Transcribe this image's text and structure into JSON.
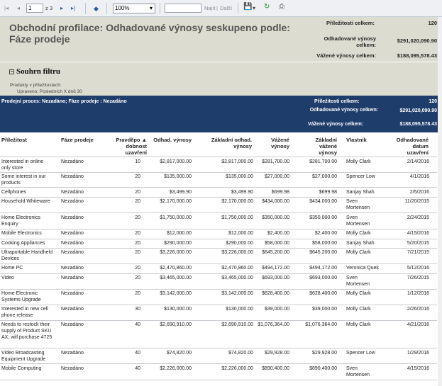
{
  "toolbar": {
    "page_current": "1",
    "page_total": "z 3",
    "zoom": "100%",
    "find_placeholder": "",
    "find_label": "Najít",
    "next_label": "Další"
  },
  "report": {
    "title": "Obchodní profilace: Odhadované výnosy seskupeno podle: Fáze prodeje",
    "summary": {
      "opportunities_label": "Příležitosti celkem:",
      "opportunities_value": "120",
      "est_revenue_label": "Odhadované výnosy celkem:",
      "est_revenue_value": "$291,020,090.90",
      "weighted_label": "Vážené výnosy celkem:",
      "weighted_value": "$188,095,578.43"
    },
    "filter": {
      "title": "Souhrn filtru",
      "line1": "Produkty v příležitostech:",
      "line2": "Upraveno: Posledních X dnů 30"
    },
    "group": {
      "label": "Prodejní proces: Nezadáno; Fáze prodeje : Nezadáno",
      "opportunities_label": "Příležitosti celkem:",
      "opportunities_value": "120",
      "est_revenue_label": "Odhadované výnosy celkem:",
      "est_revenue_value": "$291,020,090.90",
      "weighted_label": "Vážené výnosy celkem:",
      "weighted_value": "$188,095,578.43"
    },
    "columns": [
      "Příležitost",
      "Fáze prodeje",
      "Pravděpo ▲ dobnost uzavření",
      "Odhad. výnosy",
      "Základní odhad. výnosy",
      "Vážené výnosy",
      "Základní vážené výnosy",
      "Vlastník",
      "Odhadované datum uzavření"
    ],
    "rows": [
      {
        "opp": "Interested in online only store",
        "stage": "Nezadáno",
        "prob": "10",
        "est": "$2,817,000.00",
        "base_est": "$2,817,000.00",
        "weighted": "$281,700.00",
        "base_weighted": "$281,700.00",
        "owner": "Molly Clark",
        "date": "2/14/2016"
      },
      {
        "opp": "Some interest in our products",
        "stage": "Nezadáno",
        "prob": "20",
        "est": "$135,000.00",
        "base_est": "$135,000.00",
        "weighted": "$27,000.00",
        "base_weighted": "$27,000.00",
        "owner": "Spencer Low",
        "date": "4/1/2016"
      },
      {
        "opp": "Cellphones",
        "stage": "Nezadáno",
        "prob": "20",
        "est": "$3,499.90",
        "base_est": "$3,499.90",
        "weighted": "$699.98",
        "base_weighted": "$699.98",
        "owner": "Sanjay Shah",
        "date": "2/5/2016"
      },
      {
        "opp": "Household Whiteware",
        "stage": "Nezadáno",
        "prob": "20",
        "est": "$2,170,000.00",
        "base_est": "$2,170,000.00",
        "weighted": "$434,000.00",
        "base_weighted": "$434,000.00",
        "owner": "Sven Mortensen",
        "date": "11/20/2015"
      },
      {
        "opp": "Home Electronics Enquiry",
        "stage": "Nezadáno",
        "prob": "20",
        "est": "$1,750,000.00",
        "base_est": "$1,750,000.00",
        "weighted": "$350,000.00",
        "base_weighted": "$350,000.00",
        "owner": "Sven Mortensen",
        "date": "2/24/2015"
      },
      {
        "opp": "Mobile Electronics",
        "stage": "Nezadáno",
        "prob": "20",
        "est": "$12,000.00",
        "base_est": "$12,000.00",
        "weighted": "$2,400.00",
        "base_weighted": "$2,400.00",
        "owner": "Molly Clark",
        "date": "4/15/2016"
      },
      {
        "opp": "Cooking Appliances",
        "stage": "Nezadáno",
        "prob": "20",
        "est": "$290,000.00",
        "base_est": "$290,000.00",
        "weighted": "$58,000.00",
        "base_weighted": "$58,000.00",
        "owner": "Sanjay Shah",
        "date": "5/20/2015"
      },
      {
        "opp": "Ultraportable Handheld Devices",
        "stage": "Nezadáno",
        "prob": "20",
        "est": "$3,226,000.00",
        "base_est": "$3,226,000.00",
        "weighted": "$645,200.00",
        "base_weighted": "$645,200.00",
        "owner": "Molly Clark",
        "date": "7/21/2015"
      },
      {
        "opp": "Home PC",
        "stage": "Nezadáno",
        "prob": "20",
        "est": "$2,470,860.00",
        "base_est": "$2,470,860.00",
        "weighted": "$494,172.00",
        "base_weighted": "$494,172.00",
        "owner": "Veronica Quek",
        "date": "5/12/2016"
      },
      {
        "opp": "Video",
        "stage": "Nezadáno",
        "prob": "20",
        "est": "$3,465,000.00",
        "base_est": "$3,465,000.00",
        "weighted": "$693,000.00",
        "base_weighted": "$693,000.00",
        "owner": "Sven Mortensen",
        "date": "7/26/2015"
      },
      {
        "opp": "Home Electronic Systems Upgrade",
        "stage": "Nezadáno",
        "prob": "20",
        "est": "$3,142,000.00",
        "base_est": "$3,142,000.00",
        "weighted": "$628,400.00",
        "base_weighted": "$628,400.00",
        "owner": "Molly Clark",
        "date": "1/12/2016"
      },
      {
        "opp": "Interested in new cell phone release",
        "stage": "Nezadáno",
        "prob": "30",
        "est": "$130,000.00",
        "base_est": "$130,000.00",
        "weighted": "$39,000.00",
        "base_weighted": "$39,000.00",
        "owner": "Molly Clark",
        "date": "2/26/2016"
      },
      {
        "opp": "Needs to restock their supply of Product SKU AX; will purchase 4725",
        "stage": "Nezadáno",
        "prob": "40",
        "est": "$2,690,910.00",
        "base_est": "$2,690,910.00",
        "weighted": "$1,076,364.00",
        "base_weighted": "$1,076,364.00",
        "owner": "Molly Clark",
        "date": "4/21/2016"
      },
      {
        "opp": "Video Broadcasting Equipment Upgrade",
        "stage": "Nezadáno",
        "prob": "40",
        "est": "$74,820.00",
        "base_est": "$74,820.00",
        "weighted": "$29,928.00",
        "base_weighted": "$29,928.00",
        "owner": "Spencer Low",
        "date": "1/29/2016"
      },
      {
        "opp": "Mobile Computing",
        "stage": "Nezadáno",
        "prob": "40",
        "est": "$2,226,000.00",
        "base_est": "$2,226,000.00",
        "weighted": "$890,400.00",
        "base_weighted": "$890,400.00",
        "owner": "Sven Mortensen",
        "date": "4/15/2016"
      }
    ]
  }
}
